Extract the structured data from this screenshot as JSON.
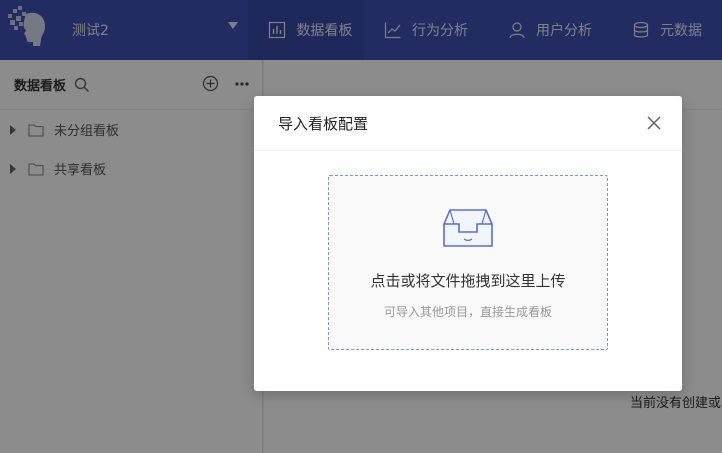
{
  "header": {
    "project_name": "测试2",
    "tabs": [
      {
        "label": "数据看板",
        "icon": "bar-chart-icon",
        "active": true
      },
      {
        "label": "行为分析",
        "icon": "trend-line-icon",
        "active": false
      },
      {
        "label": "用户分析",
        "icon": "user-icon",
        "active": false
      },
      {
        "label": "元数据",
        "icon": "database-icon",
        "active": false
      }
    ]
  },
  "sidebar": {
    "title": "数据看板",
    "items": [
      {
        "label": "未分组看板",
        "icon": "folder-icon"
      },
      {
        "label": "共享看板",
        "icon": "folder-icon"
      }
    ]
  },
  "main": {
    "empty_text": "当前没有创建或"
  },
  "modal": {
    "title": "导入看板配置",
    "dropzone_text": "点击或将文件拖拽到这里上传",
    "dropzone_hint": "可导入其他项目，直接生成看板"
  },
  "colors": {
    "nav_bg": "#3f51b5",
    "nav_active": "#3849a6",
    "accent": "#5b6fd1"
  }
}
